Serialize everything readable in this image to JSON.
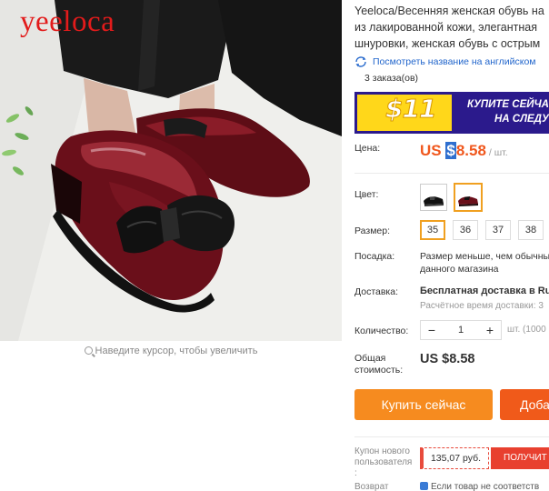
{
  "gallery": {
    "watermark": "yeeloca",
    "zoom_hint": "Наведите курсор, чтобы увеличить"
  },
  "product": {
    "title_lines": [
      "Yeeloca/Весенняя женская обувь на",
      "из лакированной кожи, элегантная",
      "шнуровки, женская обувь с острым"
    ],
    "translate_link": "Посмотреть название на английском",
    "orders": "3 заказа(ов)"
  },
  "banner": {
    "amount": "$11",
    "line1": "КУПИТЕ СЕЙЧА",
    "line2": "НА СЛЕДУ"
  },
  "price": {
    "label": "Цена:",
    "currency_prefix": "US ",
    "currency_symbol": "$",
    "value": "8.58",
    "unit": "/ шт."
  },
  "color": {
    "label": "Цвет:",
    "options": [
      "black",
      "wine-red"
    ],
    "selected": 1
  },
  "size": {
    "label": "Размер:",
    "options": [
      "35",
      "36",
      "37",
      "38"
    ],
    "selected": "35"
  },
  "fit": {
    "label": "Посадка:",
    "line1": "Размер меньше, чем обычны",
    "line2": "данного магазина"
  },
  "shipping": {
    "label": "Доставка:",
    "main": "Бесплатная доставка в Russ",
    "sub": "Расчётное время доставки: 3"
  },
  "quantity": {
    "label": "Количество:",
    "minus": "−",
    "value": "1",
    "plus": "+",
    "note": "шт. (1000 ш"
  },
  "total": {
    "label_line1": "Общая",
    "label_line2": "стоимость:",
    "value": "US $8.58"
  },
  "actions": {
    "buy_now": "Купить сейчас",
    "add_to_cart": "Доба"
  },
  "coupon": {
    "label_line1": "Купон нового",
    "label_line2": "пользователя",
    "label_line3": ":",
    "amount": "135,07 руб.",
    "button": "ПОЛУЧИТ"
  },
  "returns": {
    "label": "Возврат",
    "text": "Если товар не соответств"
  },
  "colors": {
    "accent_orange": "#f68b1f",
    "price_orange": "#f0581e",
    "banner_navy": "#2b1a8c",
    "banner_yellow": "#ffd71a",
    "link_blue": "#2266cc",
    "watermark_red": "#e21b1b"
  }
}
